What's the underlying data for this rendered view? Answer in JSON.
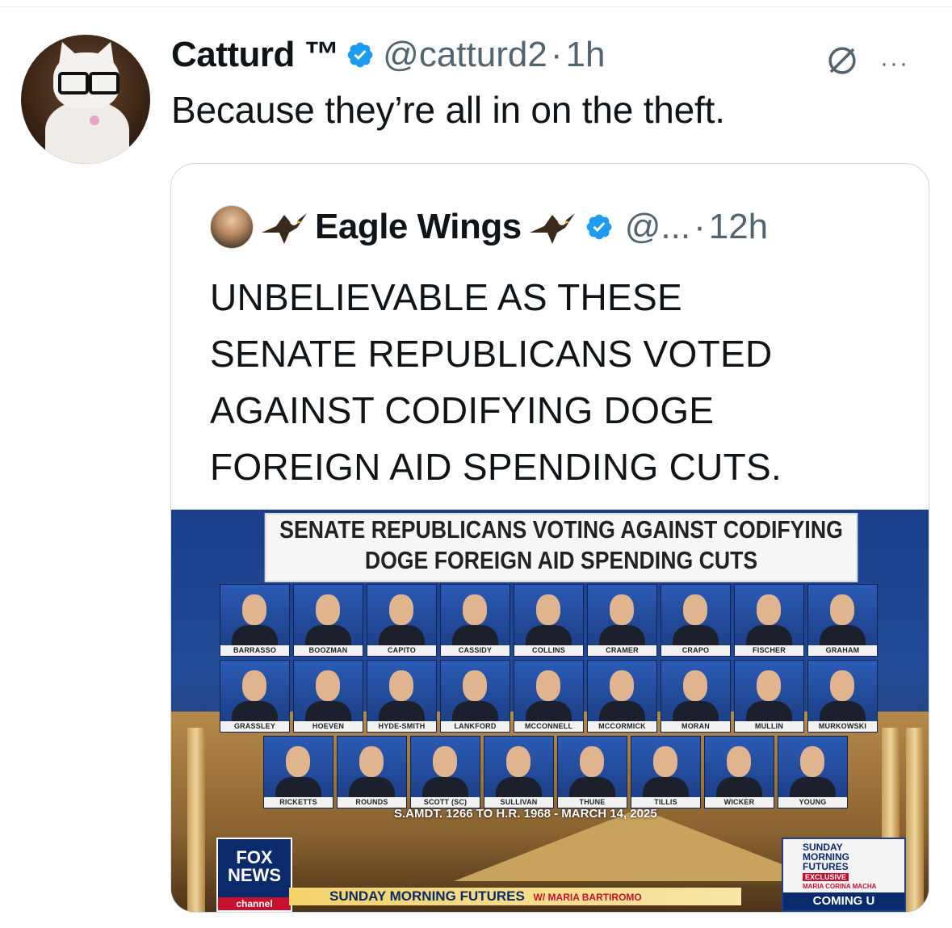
{
  "tweet": {
    "author_name": "Catturd ™",
    "handle": "@catturd2",
    "separator": "·",
    "time": "1h",
    "more": "···",
    "text": "Because they’re all in on the theft."
  },
  "quote": {
    "author_name": "Eagle Wings",
    "handle": "@...",
    "separator": "·",
    "time": "12h",
    "text": "UNBELIEVABLE  AS THESE\nSENATE REPUBLICANS  VOTED\nAGAINST CODIFYING DOGE\nFOREIGN AID SPENDING CUTS.",
    "image": {
      "banner": "SENATE REPUBLICANS VOTING AGAINST CODIFYING\nDOGE FOREIGN AID SPENDING CUTS",
      "rows": [
        [
          "BARRASSO",
          "BOOZMAN",
          "CAPITO",
          "CASSIDY",
          "COLLINS",
          "CRAMER",
          "CRAPO",
          "FISCHER",
          "GRAHAM"
        ],
        [
          "GRASSLEY",
          "HOEVEN",
          "HYDE-SMITH",
          "LANKFORD",
          "MCCONNELL",
          "MCCORMICK",
          "MORAN",
          "MULLIN",
          "MURKOWSKI"
        ],
        [
          "RICKETTS",
          "ROUNDS",
          "SCOTT (SC)",
          "SULLIVAN",
          "THUNE",
          "TILLIS",
          "WICKER",
          "YOUNG"
        ]
      ],
      "amendment": "S.AMDT. 1266 TO H.R. 1968 - MARCH 14, 2025",
      "network_logo": {
        "line1": "FOX",
        "line2": "NEWS",
        "line3": "channel"
      },
      "show_title": "SUNDAY MORNING FUTURES",
      "show_host": "W/ MARIA BARTIROMO",
      "promo": {
        "title": "SUNDAY\nMORNING\nFUTURES",
        "tag": "EXCLUSIVE",
        "guest": "MARIA CORINA MACHA",
        "coming": "COMING U"
      }
    }
  },
  "colors": {
    "verified": "#1d9bf0",
    "secondary_text": "#536471",
    "border": "#cfd9de"
  }
}
